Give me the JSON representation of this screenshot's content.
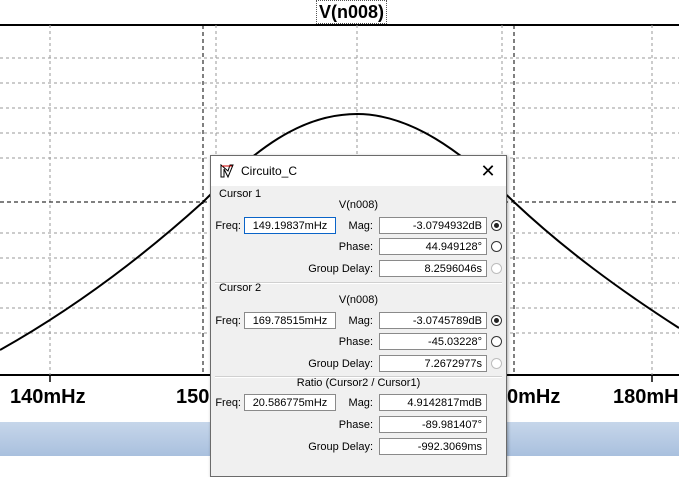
{
  "trace_title": "V(n008)",
  "x_ticks": [
    "140mHz",
    "150",
    "0mHz",
    "180mH"
  ],
  "dialog": {
    "title": "Circuito_C",
    "close_symbol": "✕",
    "cursor1": {
      "label": "Cursor 1",
      "trace": "V(n008)",
      "freq_label": "Freq:",
      "freq": "149.19837mHz",
      "mag_label": "Mag:",
      "mag": "-3.0794932dB",
      "phase_label": "Phase:",
      "phase": "44.949128°",
      "gd_label": "Group Delay:",
      "gd": "8.2596046s"
    },
    "cursor2": {
      "label": "Cursor 2",
      "trace": "V(n008)",
      "freq_label": "Freq:",
      "freq": "169.78515mHz",
      "mag_label": "Mag:",
      "mag": "-3.0745789dB",
      "phase_label": "Phase:",
      "phase": "-45.03228°",
      "gd_label": "Group Delay:",
      "gd": "7.2672977s"
    },
    "ratio": {
      "label": "Ratio (Cursor2 / Cursor1)",
      "freq_label": "Freq:",
      "freq": "20.586775mHz",
      "mag_label": "Mag:",
      "mag": "4.9142817mdB",
      "phase_label": "Phase:",
      "phase": "-89.981407°",
      "gd_label": "Group Delay:",
      "gd": "-992.3069ms"
    }
  }
}
